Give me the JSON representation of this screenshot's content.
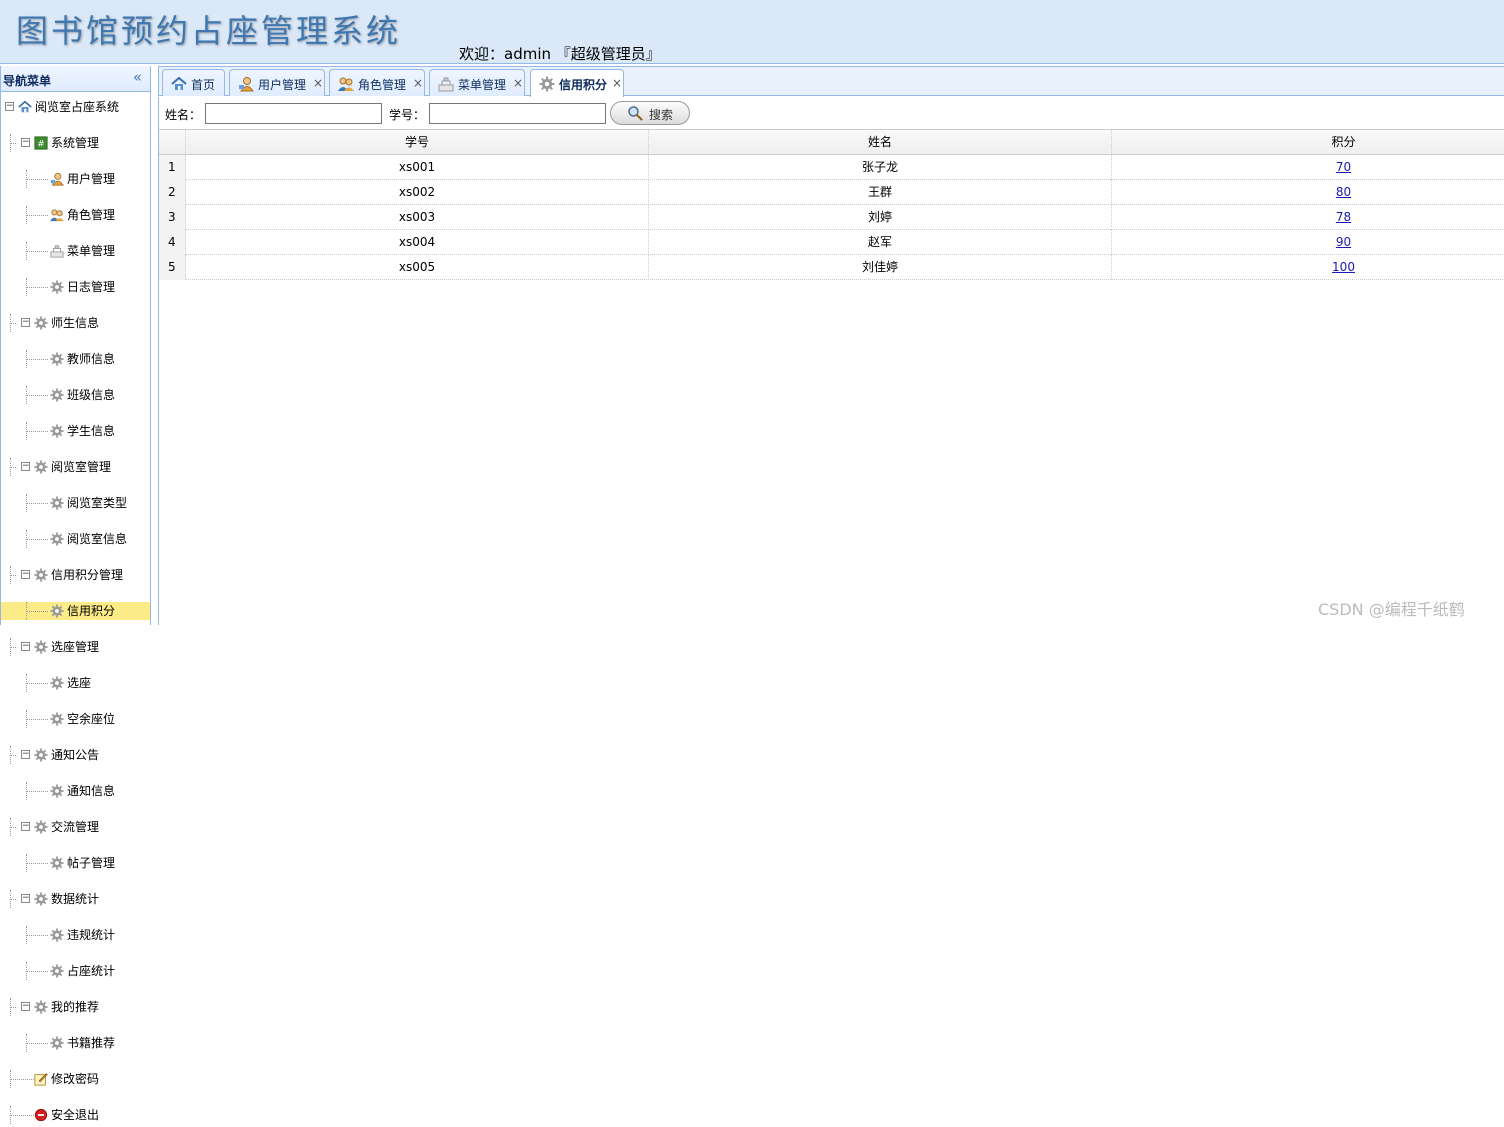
{
  "header": {
    "title": "图书馆预约占座管理系统",
    "welcome": "欢迎：admin 『超级管理员』"
  },
  "sidebar": {
    "title": "导航菜单",
    "collapse_glyph": "«",
    "tree": [
      {
        "label": "阅览室占座系统",
        "level": 0,
        "expander": "−",
        "icon": "home-icon"
      },
      {
        "label": "系统管理",
        "level": 1,
        "expander": "−",
        "icon": "green-folder-icon"
      },
      {
        "label": "用户管理",
        "level": 2,
        "icon": "user-icon"
      },
      {
        "label": "角色管理",
        "level": 2,
        "icon": "users-icon"
      },
      {
        "label": "菜单管理",
        "level": 2,
        "icon": "menu-icon"
      },
      {
        "label": "日志管理",
        "level": 2,
        "icon": "gear-icon"
      },
      {
        "label": "师生信息",
        "level": 1,
        "expander": "−",
        "icon": "gear-icon"
      },
      {
        "label": "教师信息",
        "level": 2,
        "icon": "gear-icon"
      },
      {
        "label": "班级信息",
        "level": 2,
        "icon": "gear-icon"
      },
      {
        "label": "学生信息",
        "level": 2,
        "icon": "gear-icon"
      },
      {
        "label": "阅览室管理",
        "level": 1,
        "expander": "−",
        "icon": "gear-icon"
      },
      {
        "label": "阅览室类型",
        "level": 2,
        "icon": "gear-icon"
      },
      {
        "label": "阅览室信息",
        "level": 2,
        "icon": "gear-icon"
      },
      {
        "label": "信用积分管理",
        "level": 1,
        "expander": "−",
        "icon": "gear-icon"
      },
      {
        "label": "信用积分",
        "level": 2,
        "icon": "gear-icon",
        "selected": true
      },
      {
        "label": "选座管理",
        "level": 1,
        "expander": "−",
        "icon": "gear-icon"
      },
      {
        "label": "选座",
        "level": 2,
        "icon": "gear-icon"
      },
      {
        "label": "空余座位",
        "level": 2,
        "icon": "gear-icon"
      },
      {
        "label": "通知公告",
        "level": 1,
        "expander": "−",
        "icon": "gear-icon"
      },
      {
        "label": "通知信息",
        "level": 2,
        "icon": "gear-icon"
      },
      {
        "label": "交流管理",
        "level": 1,
        "expander": "−",
        "icon": "gear-icon"
      },
      {
        "label": "帖子管理",
        "level": 2,
        "icon": "gear-icon"
      },
      {
        "label": "数据统计",
        "level": 1,
        "expander": "−",
        "icon": "gear-icon"
      },
      {
        "label": "违规统计",
        "level": 2,
        "icon": "gear-icon"
      },
      {
        "label": "占座统计",
        "level": 2,
        "icon": "gear-icon"
      },
      {
        "label": "我的推荐",
        "level": 1,
        "expander": "−",
        "icon": "gear-icon"
      },
      {
        "label": "书籍推荐",
        "level": 2,
        "icon": "gear-icon"
      },
      {
        "label": "修改密码",
        "level": 1,
        "icon": "edit-icon"
      },
      {
        "label": "安全退出",
        "level": 1,
        "icon": "exit-icon"
      }
    ]
  },
  "tabs": [
    {
      "label": "首页",
      "icon": "home-icon",
      "closable": false
    },
    {
      "label": "用户管理",
      "icon": "user-icon",
      "closable": true
    },
    {
      "label": "角色管理",
      "icon": "users-icon",
      "closable": true
    },
    {
      "label": "菜单管理",
      "icon": "menu-icon",
      "closable": true
    },
    {
      "label": "信用积分",
      "icon": "gear-icon",
      "closable": true,
      "active": true
    }
  ],
  "search": {
    "name_label": "姓名：",
    "name_value": "",
    "id_label": "学号：",
    "id_value": "",
    "button_label": "搜索"
  },
  "grid": {
    "columns": [
      "学号",
      "姓名",
      "积分"
    ],
    "rows": [
      {
        "num": "1",
        "id": "xs001",
        "name": "张子龙",
        "score": "70"
      },
      {
        "num": "2",
        "id": "xs002",
        "name": "王群",
        "score": "80"
      },
      {
        "num": "3",
        "id": "xs003",
        "name": "刘婷",
        "score": "78"
      },
      {
        "num": "4",
        "id": "xs004",
        "name": "赵军",
        "score": "90"
      },
      {
        "num": "5",
        "id": "xs005",
        "name": "刘佳婷",
        "score": "100"
      }
    ]
  },
  "watermark": "CSDN @编程千纸鹤",
  "colors": {
    "header_bg": "#dbe8f8",
    "border": "#95b8e7",
    "selected": "#fbec88",
    "link": "#1a1ab8"
  }
}
